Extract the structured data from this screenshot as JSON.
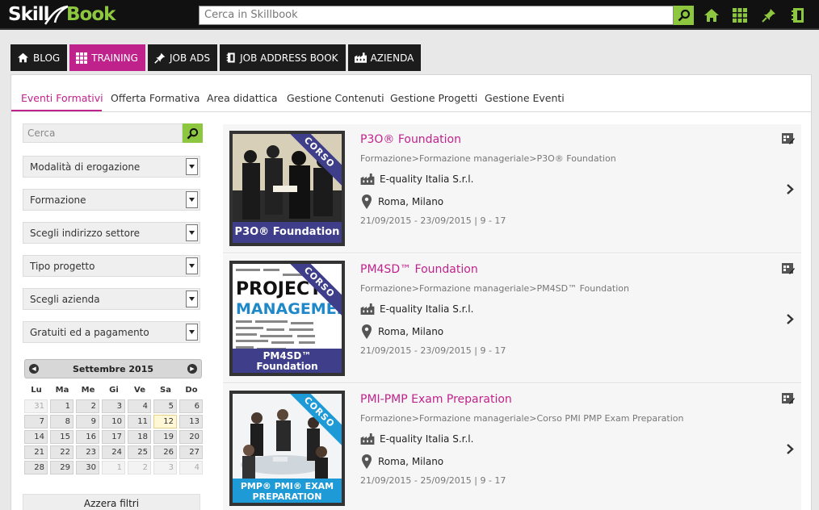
{
  "topbar": {
    "logo_skill": "Skill",
    "logo_book": "Book",
    "search_placeholder": "Cerca in Skillbook",
    "icons": [
      "search-icon",
      "home-icon",
      "grid-icon",
      "pin-icon",
      "bookmark-icon"
    ]
  },
  "colors": {
    "accent": "#c0228c",
    "green": "#8dc63f",
    "dark": "#1c1c1c"
  },
  "mainnav": [
    {
      "label": "BLOG",
      "icon": "home-icon"
    },
    {
      "label": "TRAINING",
      "icon": "grid-icon",
      "active": true
    },
    {
      "label": "JOB ADS",
      "icon": "pin-icon"
    },
    {
      "label": "JOB ADDRESS BOOK",
      "icon": "book-icon"
    },
    {
      "label": "AZIENDA",
      "icon": "factory-icon"
    }
  ],
  "subnav": [
    "Eventi Formativi",
    "Offerta Formativa",
    "Area didattica",
    "Gestione Contenuti",
    "Gestione Progetti",
    "Gestione Eventi"
  ],
  "filters": {
    "search_placeholder": "Cerca",
    "selects": [
      "Modalità di erogazione",
      "Formazione",
      "Scegli indirizzo settore",
      "Tipo progetto",
      "Scegli azienda",
      "Gratuiti ed a pagamento"
    ],
    "reset_label": "Azzera filtri"
  },
  "calendar": {
    "month": "Settembre 2015",
    "dow": [
      "Lu",
      "Ma",
      "Me",
      "Gi",
      "Ve",
      "Sa",
      "Do"
    ],
    "weeks": [
      [
        "31",
        "1",
        "2",
        "3",
        "4",
        "5",
        "6"
      ],
      [
        "7",
        "8",
        "9",
        "10",
        "11",
        "12",
        "13"
      ],
      [
        "14",
        "15",
        "16",
        "17",
        "18",
        "19",
        "20"
      ],
      [
        "21",
        "22",
        "23",
        "24",
        "25",
        "26",
        "27"
      ],
      [
        "28",
        "29",
        "30",
        "1",
        "2",
        "3",
        "4"
      ]
    ]
  },
  "events": [
    {
      "title": "P3O® Foundation",
      "path": "Formazione>Formazione manageriale>P3O® Foundation",
      "company": "E-quality Italia S.r.l.",
      "location": "Roma, Milano",
      "dates": "21/09/2015 - 23/09/2015 | 9 - 17",
      "badge": "CORSO",
      "thumb_caption": "P3O® Foundation"
    },
    {
      "title": "PM4SD™ Foundation",
      "path": "Formazione>Formazione manageriale>PM4SD™ Foundation",
      "company": "E-quality Italia S.r.l.",
      "location": "Roma, Milano",
      "dates": "21/09/2015 - 23/09/2015 | 9 - 17",
      "badge": "CORSO",
      "thumb_caption": "PM4SD™ Foundation",
      "thumb_text_1": "PROJECT",
      "thumb_text_2": "MANAGEMENT"
    },
    {
      "title": "PMI-PMP Exam Preparation",
      "path": "Formazione>Formazione manageriale>Corso PMI PMP Exam Preparation",
      "company": "E-quality Italia S.r.l.",
      "location": "Roma, Milano",
      "dates": "21/09/2015 - 25/09/2015 | 9 - 17",
      "badge": "CORSO",
      "thumb_caption": "PMP® PMI® EXAM PREPARATION"
    }
  ]
}
